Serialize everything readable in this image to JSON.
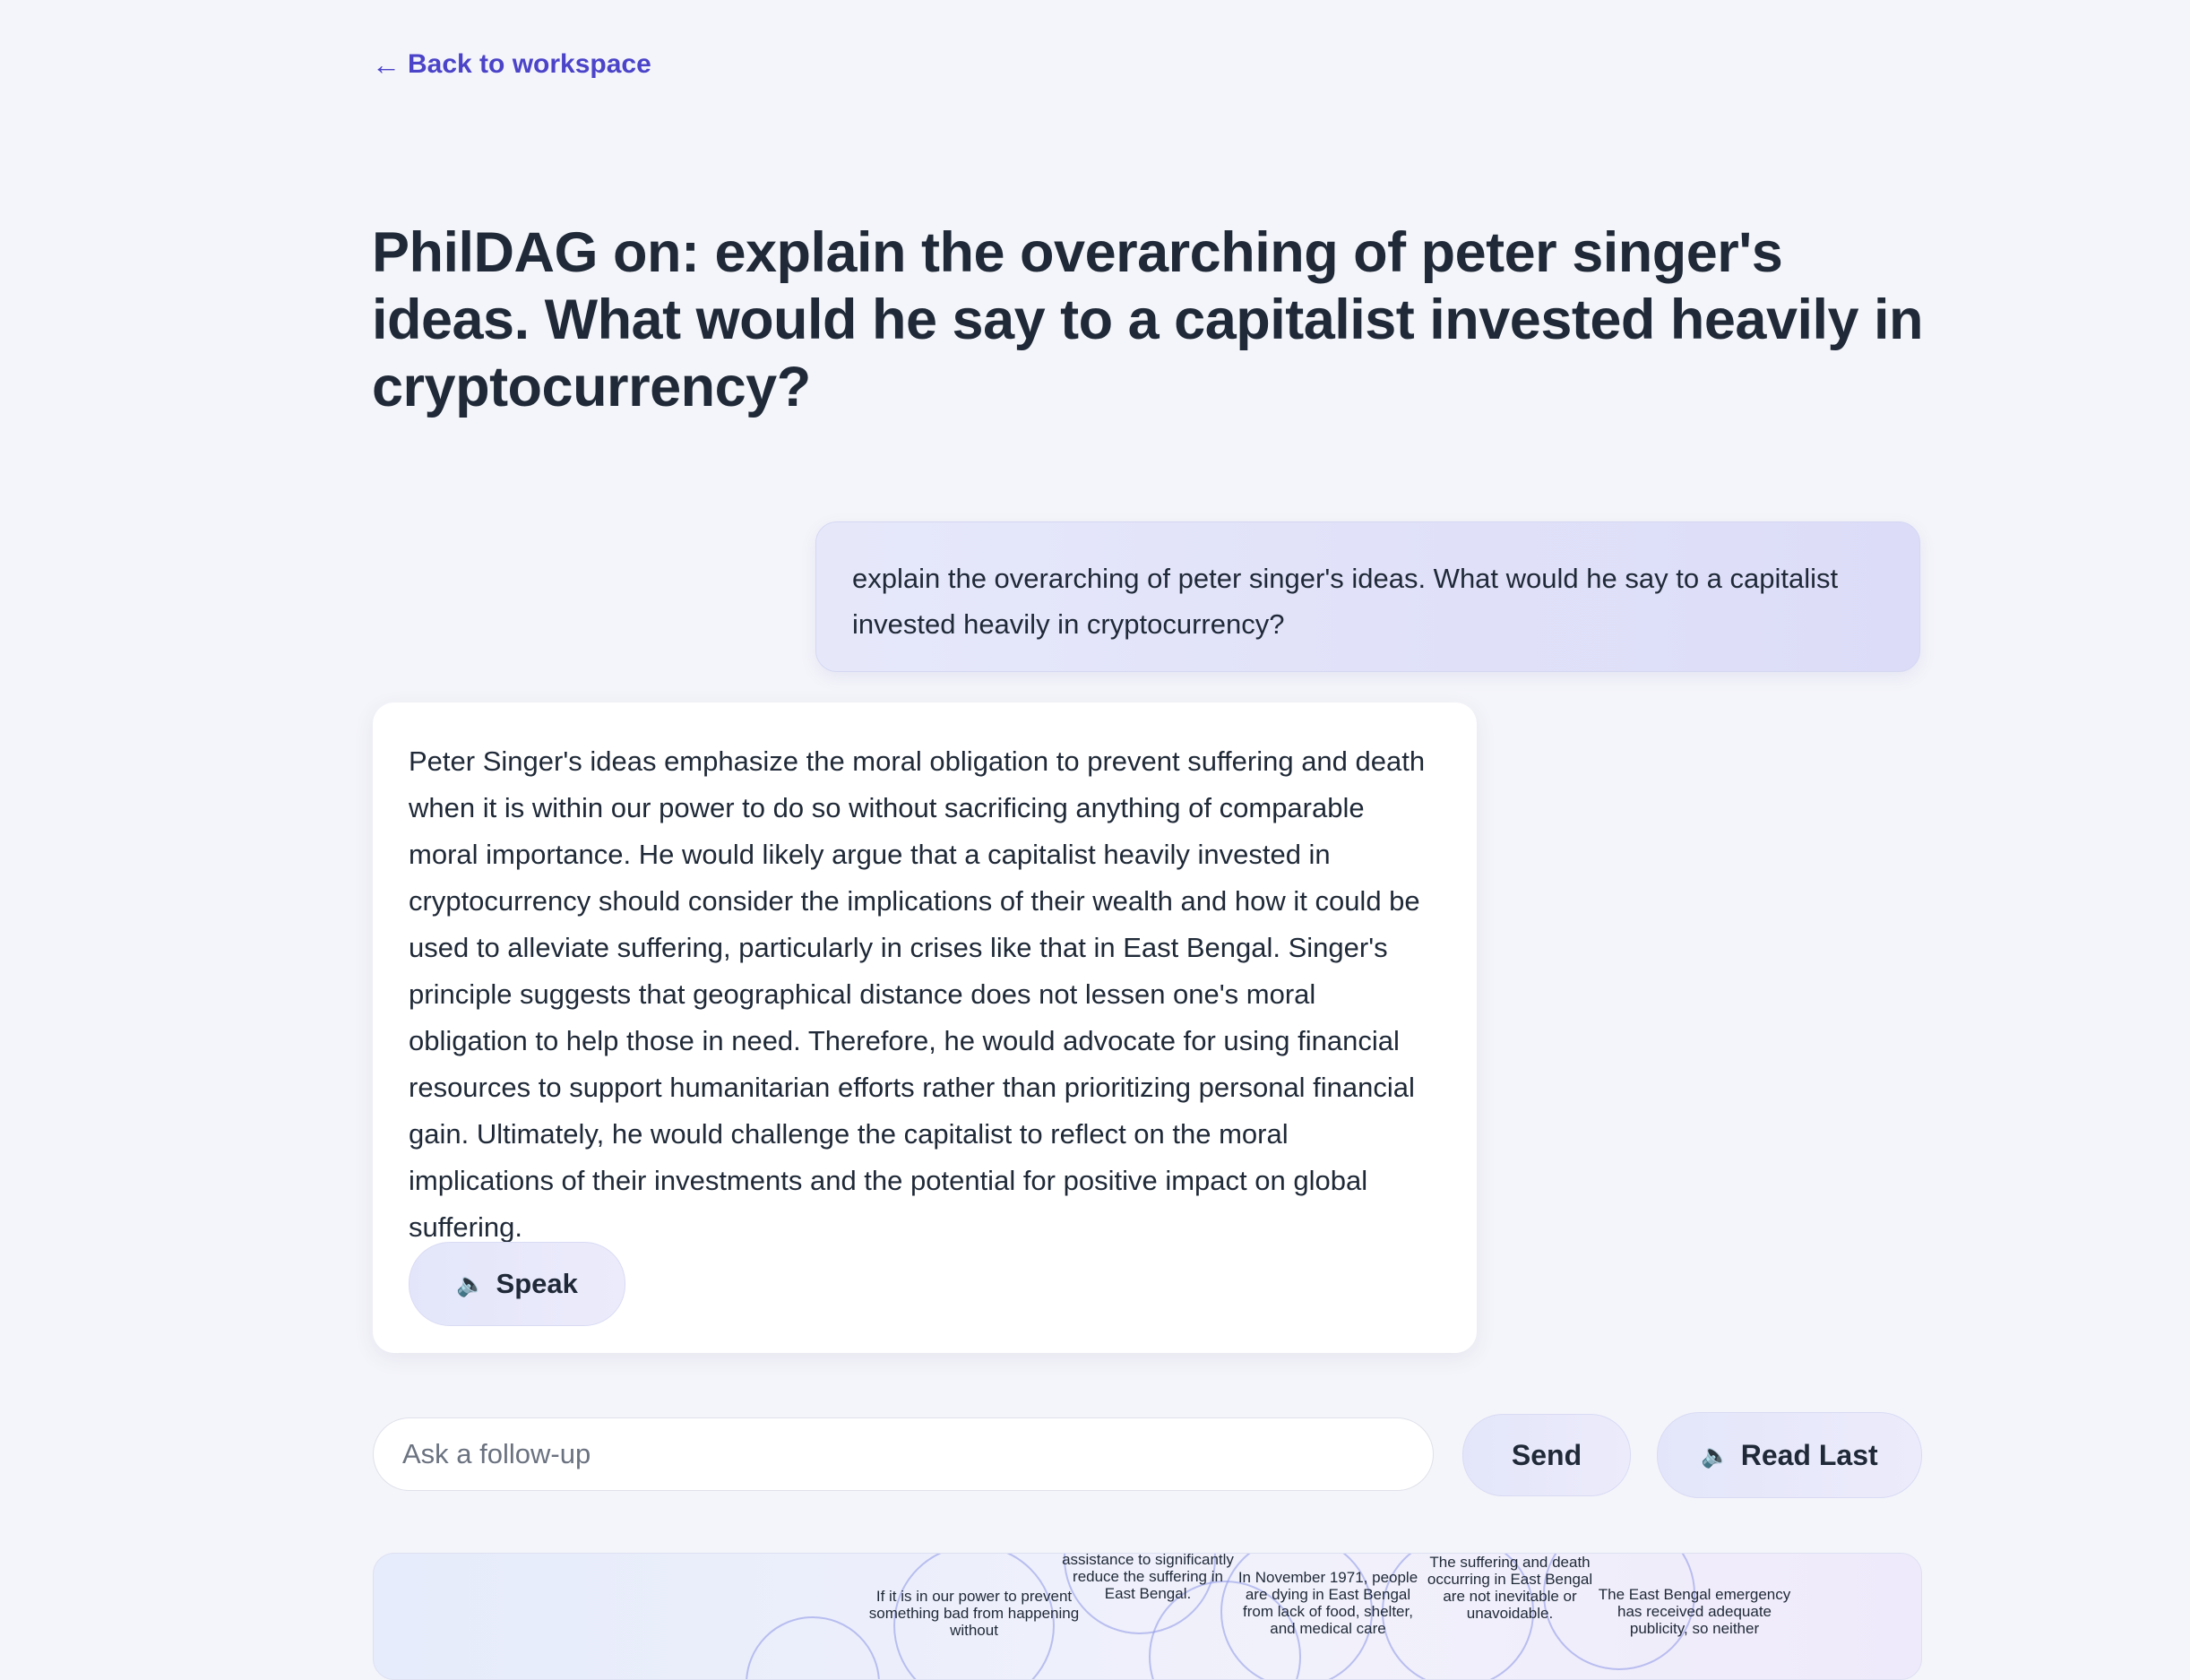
{
  "nav": {
    "back_label": "Back to workspace",
    "back_icon": "arrow-left-icon"
  },
  "page_title": "PhilDAG on: explain the overarching of peter singer's ideas. What would he say to a capitalist invested heavily in cryptocurrency?",
  "conversation": {
    "user_message": "explain the overarching of peter singer's ideas. What would he say to a capitalist invested heavily in cryptocurrency?",
    "assistant_message": "Peter Singer's ideas emphasize the moral obligation to prevent suffering and death when it is within our power to do so without sacrificing anything of comparable moral importance. He would likely argue that a capitalist heavily invested in cryptocurrency should consider the implications of their wealth and how it could be used to alleviate suffering, particularly in crises like that in East Bengal. Singer's principle suggests that geographical distance does not lessen one's moral obligation to help those in need. Therefore, he would advocate for using financial resources to support humanitarian efforts rather than prioritizing personal financial gain. Ultimately, he would challenge the capitalist to reflect on the moral implications of their investments and the potential for positive impact on global suffering.",
    "speak_label": "Speak",
    "speak_icon": "speaker-icon"
  },
  "composer": {
    "placeholder": "Ask a follow-up",
    "value": "",
    "send_label": "Send",
    "read_last_label": "Read Last",
    "read_last_icon": "speaker-icon"
  },
  "graph": {
    "nodes": [
      {
        "label": "If it is in our power to prevent something bad from happening without"
      },
      {
        "label": "assistance to significantly reduce the suffering in East Bengal."
      },
      {
        "label": "In November 1971, people are dying in East Bengal from lack of food, shelter, and medical care"
      },
      {
        "label": "The suffering and death occurring in East Bengal are not inevitable or unavoidable."
      },
      {
        "label": "The East Bengal emergency has received adequate publicity, so neither"
      }
    ]
  },
  "colors": {
    "accent": "#4b44c8",
    "text": "#1f2937",
    "background": "#f4f5fa"
  }
}
